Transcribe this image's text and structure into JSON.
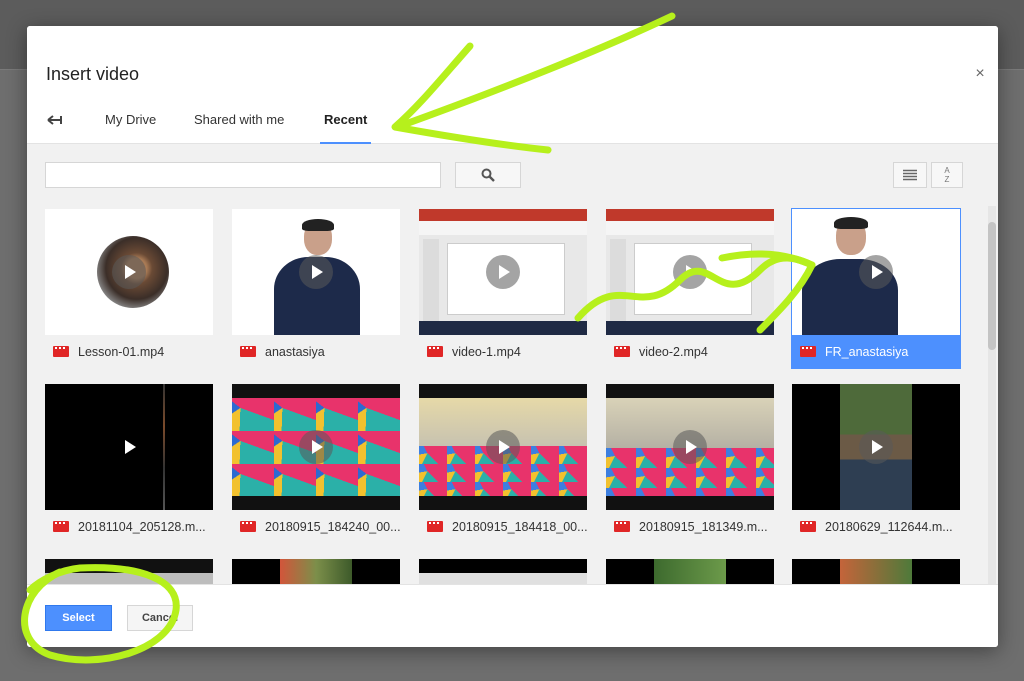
{
  "dialog": {
    "title": "Insert video",
    "close_symbol": "×"
  },
  "tabs": [
    {
      "label": "My Drive",
      "active": false
    },
    {
      "label": "Shared with me",
      "active": false
    },
    {
      "label": "Recent",
      "active": true
    }
  ],
  "search": {
    "value": "",
    "placeholder": ""
  },
  "sort_label_top": "A",
  "sort_label_bottom": "Z",
  "items": [
    {
      "name": "Lesson-01.mp4",
      "thumb": "fox"
    },
    {
      "name": "anastasiya",
      "thumb": "person"
    },
    {
      "name": "video-1.mp4",
      "thumb": "slides"
    },
    {
      "name": "video-2.mp4",
      "thumb": "slides"
    },
    {
      "name": "FR_anastasiya",
      "thumb": "person",
      "selected": true
    },
    {
      "name": "20181104_205128.m...",
      "thumb": "black"
    },
    {
      "name": "20180915_184240_00...",
      "thumb": "foam"
    },
    {
      "name": "20180915_184418_00...",
      "thumb": "foam-wide"
    },
    {
      "name": "20180915_181349.m...",
      "thumb": "foam-wide"
    },
    {
      "name": "20180629_112644.m...",
      "thumb": "outdoor"
    }
  ],
  "footer": {
    "select_label": "Select",
    "cancel_label": "Cancel"
  },
  "colors": {
    "accent": "#4d90fe",
    "file_icon": "#e02626",
    "annotation": "#b6f01c"
  },
  "icons": {
    "back": "back-arrow-icon",
    "search": "magnifier-icon",
    "list": "list-view-icon",
    "sort": "sort-az-icon",
    "file": "video-file-icon",
    "play": "play-icon"
  }
}
